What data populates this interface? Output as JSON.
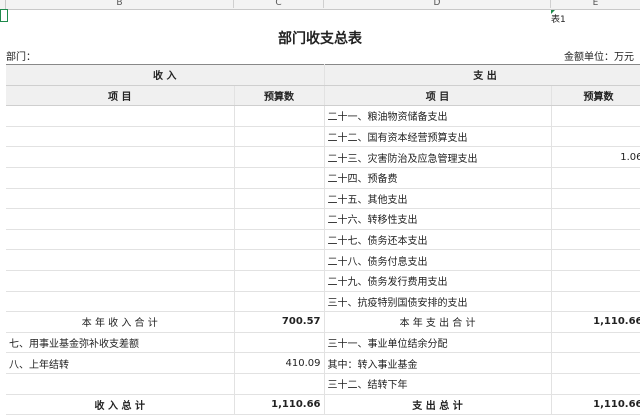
{
  "columns": [
    "B",
    "C",
    "D",
    "E"
  ],
  "sheet_tag": "表1",
  "title": "部门收支总表",
  "dept_label": "部门：",
  "unit_label": "金额单位：万元",
  "header": {
    "income": "收    入",
    "expense": "支    出",
    "item": "项      目",
    "budget": "预算数"
  },
  "rows": [
    {
      "lname": "",
      "lval": "",
      "rname": "二十一、粮油物资储备支出",
      "rval": ""
    },
    {
      "lname": "",
      "lval": "",
      "rname": "二十二、国有资本经营预算支出",
      "rval": ""
    },
    {
      "lname": "",
      "lval": "",
      "rname": "二十三、灾害防治及应急管理支出",
      "rval": "1.06"
    },
    {
      "lname": "",
      "lval": "",
      "rname": "二十四、预备费",
      "rval": ""
    },
    {
      "lname": "",
      "lval": "",
      "rname": "二十五、其他支出",
      "rval": ""
    },
    {
      "lname": "",
      "lval": "",
      "rname": "二十六、转移性支出",
      "rval": ""
    },
    {
      "lname": "",
      "lval": "",
      "rname": "二十七、债务还本支出",
      "rval": ""
    },
    {
      "lname": "",
      "lval": "",
      "rname": "二十八、债务付息支出",
      "rval": ""
    },
    {
      "lname": "",
      "lval": "",
      "rname": "二十九、债务发行费用支出",
      "rval": ""
    },
    {
      "lname": "",
      "lval": "",
      "rname": "三十、抗疫特别国债安排的支出",
      "rval": ""
    },
    {
      "lname": "本 年 收 入 合 计",
      "lval": "700.57",
      "rname": "本 年 支 出 合 计",
      "rval": "1,110.66",
      "kind": "subtotal"
    },
    {
      "lname": "七、用事业基金弥补收支差额",
      "lval": "",
      "rname": "三十一、事业单位结余分配",
      "rval": ""
    },
    {
      "lname": "八、上年结转",
      "lval": "410.09",
      "rname": "   其中：转入事业基金",
      "rval": ""
    },
    {
      "lname": "",
      "lval": "",
      "rname": "三十二、结转下年",
      "rval": ""
    },
    {
      "lname": "收  入  总  计",
      "lval": "1,110.66",
      "rname": "支  出  总  计",
      "rval": "1,110.66",
      "kind": "total"
    }
  ]
}
